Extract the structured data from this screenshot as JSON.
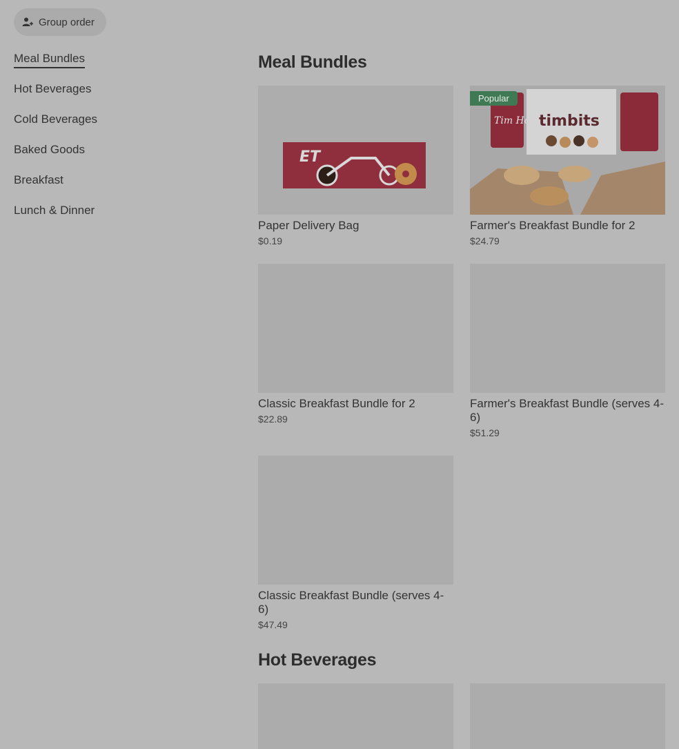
{
  "group_order": {
    "label": "Group order",
    "icon": "person-add-icon"
  },
  "sidebar": {
    "items": [
      {
        "label": "Meal Bundles",
        "active": true
      },
      {
        "label": "Hot Beverages"
      },
      {
        "label": "Cold Beverages"
      },
      {
        "label": "Baked Goods"
      },
      {
        "label": "Breakfast"
      },
      {
        "label": "Lunch & Dinner"
      }
    ]
  },
  "sections": [
    {
      "title": "Meal Bundles",
      "items": [
        {
          "name": "Paper Delivery Bag",
          "price": "$0.19",
          "image": "delivery-bag-image"
        },
        {
          "name": "Farmer's Breakfast Bundle for 2",
          "price": "$24.79",
          "badge": "Popular",
          "image": "breakfast-bundle-image"
        },
        {
          "name": "Classic Breakfast Bundle for 2",
          "price": "$22.89"
        },
        {
          "name": "Farmer's Breakfast Bundle (serves 4-6)",
          "price": "$51.29"
        },
        {
          "name": "Classic Breakfast Bundle (serves 4-6)",
          "price": "$47.49"
        }
      ]
    },
    {
      "title": "Hot Beverages",
      "items": []
    }
  ],
  "brand": {
    "packaging_text": "timbits",
    "cup_text": "Tim Hortons"
  }
}
